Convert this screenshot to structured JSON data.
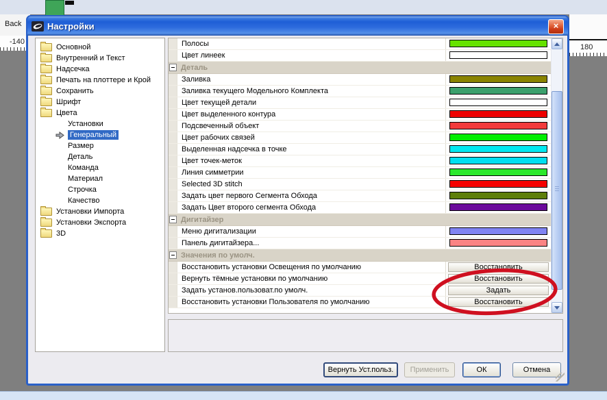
{
  "window": {
    "title": "Настройки"
  },
  "desktop": {
    "back_label": "Back",
    "ruler_left_value": "-140",
    "ruler_right_value": "180"
  },
  "colors": {
    "tree_selection": "#316AC5",
    "annotation_red": "#CF1020"
  },
  "tree": {
    "items": [
      {
        "label": "Основной",
        "level": 0,
        "icon": "folder",
        "selected": false
      },
      {
        "label": "Внутренний и Текст",
        "level": 0,
        "icon": "folder",
        "selected": false
      },
      {
        "label": "Надсечка",
        "level": 0,
        "icon": "folder",
        "selected": false
      },
      {
        "label": "Печать на плоттере и Крой",
        "level": 0,
        "icon": "folder",
        "selected": false
      },
      {
        "label": "Сохранить",
        "level": 0,
        "icon": "folder",
        "selected": false
      },
      {
        "label": "Шрифт",
        "level": 0,
        "icon": "folder",
        "selected": false
      },
      {
        "label": "Цвета",
        "level": 0,
        "icon": "folder-open",
        "selected": false
      },
      {
        "label": "Установки",
        "level": 1,
        "icon": "none",
        "selected": false
      },
      {
        "label": "Генеральный",
        "level": 1,
        "icon": "none",
        "selected": true
      },
      {
        "label": "Размер",
        "level": 1,
        "icon": "none",
        "selected": false
      },
      {
        "label": "Деталь",
        "level": 1,
        "icon": "none",
        "selected": false
      },
      {
        "label": "Команда",
        "level": 1,
        "icon": "none",
        "selected": false
      },
      {
        "label": "Материал",
        "level": 1,
        "icon": "none",
        "selected": false
      },
      {
        "label": "Строчка",
        "level": 1,
        "icon": "none",
        "selected": false
      },
      {
        "label": "Качество",
        "level": 1,
        "icon": "none",
        "selected": false
      },
      {
        "label": "Установки Импорта",
        "level": 0,
        "icon": "folder",
        "selected": false
      },
      {
        "label": "Установки Экспорта",
        "level": 0,
        "icon": "folder",
        "selected": false
      },
      {
        "label": "3D",
        "level": 0,
        "icon": "folder",
        "selected": false
      }
    ]
  },
  "grid": {
    "rows": [
      {
        "type": "color",
        "label": "Полосы",
        "color": "#66E200"
      },
      {
        "type": "color",
        "label": "Цвет линеек",
        "color": "#FFFFFF"
      },
      {
        "type": "section",
        "label": "Деталь"
      },
      {
        "type": "color",
        "label": "Заливка",
        "color": "#8A8400"
      },
      {
        "type": "color",
        "label": "Заливка текущего Модельного Комплекта",
        "color": "#3BA06C"
      },
      {
        "type": "color",
        "label": "Цвет текущей детали",
        "color": "#FFFFFF"
      },
      {
        "type": "color",
        "label": "Цвет выделенного контура",
        "color": "#EE0000"
      },
      {
        "type": "color",
        "label": "Подсвеченный объект",
        "color": "#F23B3B"
      },
      {
        "type": "color",
        "label": "Цвет рабочих связей",
        "color": "#00EE00"
      },
      {
        "type": "color",
        "label": "Выделенная надсечка в точке",
        "color": "#00E8F0"
      },
      {
        "type": "color",
        "label": "Цвет точек-меток",
        "color": "#00DFF0"
      },
      {
        "type": "color",
        "label": "Линия симметрии",
        "color": "#2BE82B"
      },
      {
        "type": "color",
        "label": "Selected 3D stitch",
        "color": "#F50000"
      },
      {
        "type": "color",
        "label": "Задать цвет первого Сегмента Обхода",
        "color": "#5E7F0A"
      },
      {
        "type": "color",
        "label": "Задать Цвет второго сегмента Обхода",
        "color": "#6B0A9B"
      },
      {
        "type": "section",
        "label": "Дигитайзер"
      },
      {
        "type": "color",
        "label": "Меню дигитализации",
        "color": "#8084F2"
      },
      {
        "type": "color",
        "label": "Панель дигитайзера...",
        "color": "#FA8484"
      },
      {
        "type": "section",
        "label": "Значения по умолч."
      },
      {
        "type": "button",
        "label": "Восстановить установки Освещения по умолчанию",
        "button": "Восстановить"
      },
      {
        "type": "button",
        "label": "Вернуть тёмные установки по умолчанию",
        "button": "Восстановить"
      },
      {
        "type": "button",
        "label": "Задать установ.пользоват.по умолч.",
        "button": "Задать",
        "annotated": true
      },
      {
        "type": "button",
        "label": "Восстановить установки Пользователя по умолчанию",
        "button": "Восстановить"
      }
    ]
  },
  "footer": {
    "buttons": [
      {
        "label": "Вернуть Уст.польз.",
        "state": "focused"
      },
      {
        "label": "Применить",
        "state": "disabled"
      },
      {
        "label": "ОК",
        "state": "default"
      },
      {
        "label": "Отмена",
        "state": "normal"
      }
    ]
  }
}
